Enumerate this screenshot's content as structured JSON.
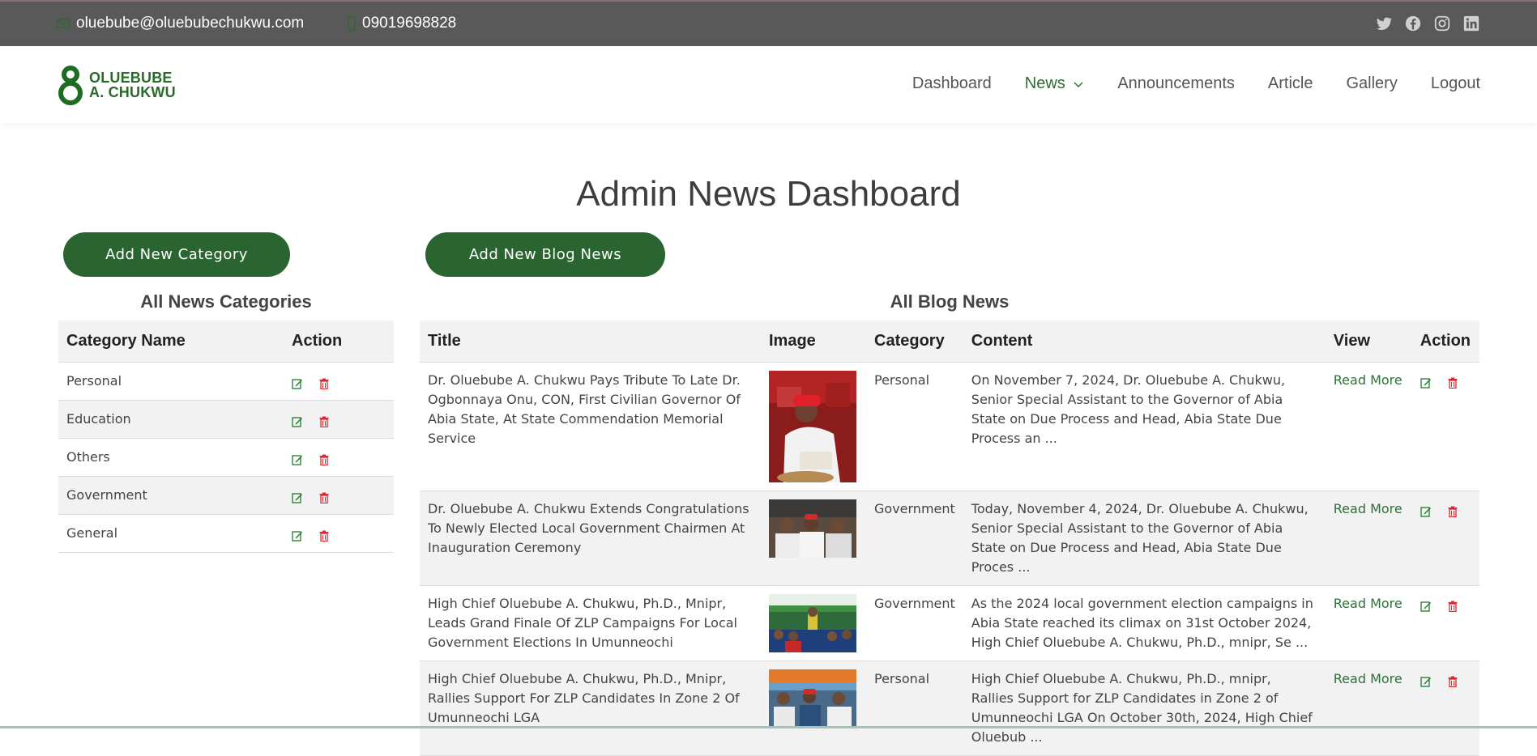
{
  "topbar": {
    "email": "oluebube@oluebubechukwu.com",
    "phone": "09019698828",
    "social_icons": [
      "twitter-icon",
      "facebook-icon",
      "instagram-icon",
      "linkedin-icon"
    ]
  },
  "logo": {
    "line1": "OLUEBUBE",
    "line2": "A. CHUKWU"
  },
  "nav": [
    {
      "label": "Dashboard"
    },
    {
      "label": "News"
    },
    {
      "label": "Announcements"
    },
    {
      "label": "Article"
    },
    {
      "label": "Gallery"
    },
    {
      "label": "Logout"
    }
  ],
  "page_title": "Admin News Dashboard",
  "buttons": {
    "add_category": "Add New Category",
    "add_blog": "Add New Blog News"
  },
  "categories": {
    "title": "All News Categories",
    "headers": {
      "name": "Category Name",
      "action": "Action"
    },
    "rows": [
      "Personal",
      "Education",
      "Others",
      "Government",
      "General"
    ]
  },
  "blog": {
    "title": "All Blog News",
    "headers": {
      "title": "Title",
      "image": "Image",
      "category": "Category",
      "content": "Content",
      "view": "View",
      "action": "Action"
    },
    "rows": [
      {
        "title": "Dr. Oluebube A. Chukwu Pays Tribute To Late Dr. Ogbonnaya Onu, CON, First Civilian Governor Of Abia State, At State Commendation Memorial Service",
        "category": "Personal",
        "content": "On November 7, 2024, Dr. Oluebube A. Chukwu, Senior Special Assistant to the Governor of Abia State on Due Process and Head, Abia State Due Process an ...",
        "view": "Read More"
      },
      {
        "title": "Dr. Oluebube A. Chukwu Extends Congratulations To Newly Elected Local Government Chairmen At Inauguration Ceremony",
        "category": "Government",
        "content": "Today, November 4, 2024, Dr. Oluebube A. Chukwu, Senior Special Assistant to the Governor of Abia State on Due Process and Head, Abia State Due Proces ...",
        "view": "Read More"
      },
      {
        "title": "High Chief Oluebube A. Chukwu, Ph.D., Mnipr, Leads Grand Finale Of ZLP Campaigns For Local Government Elections In Umunneochi",
        "category": "Government",
        "content": "As the 2024 local government election campaigns in Abia State reached its climax on 31st October 2024, High Chief Oluebube A. Chukwu, Ph.D., mnipr, Se ...",
        "view": "Read More"
      },
      {
        "title": "High Chief Oluebube A. Chukwu, Ph.D., Mnipr, Rallies Support For ZLP Candidates In Zone 2 Of Umunneochi LGA",
        "category": "Personal",
        "content": "High Chief Oluebube A. Chukwu, Ph.D., mnipr, Rallies Support for ZLP Candidates in Zone 2 of Umunneochi LGA On October 30th, 2024, High Chief Oluebub ...",
        "view": "Read More"
      }
    ]
  },
  "colors": {
    "brand_green": "#2a6430",
    "topbar": "#595959",
    "delete_red": "#e0262c"
  }
}
